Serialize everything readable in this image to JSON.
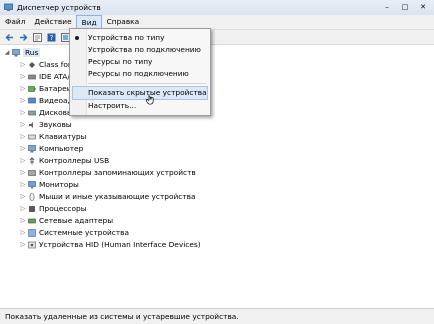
{
  "window": {
    "title": "Диспетчер устройств",
    "controls": [
      "–",
      "□",
      "✕"
    ]
  },
  "menubar": {
    "items": [
      "Файл",
      "Действие",
      "Вид",
      "Справка"
    ],
    "active": "Вид"
  },
  "toolbar": {
    "icons": [
      "back-arrow-icon",
      "forward-arrow-icon",
      "properties-icon",
      "help-icon",
      "view-icon"
    ]
  },
  "tree": {
    "root": "Rus",
    "items": [
      "Class for I",
      "IDE ATA/",
      "Батареи",
      "Видеоада",
      "Дисковы",
      "Звуковы",
      "Клавиатуры",
      "Компьютер",
      "Контроллеры USB",
      "Контроллеры запоминающих устройств",
      "Мониторы",
      "Мыши и иные указывающие устройства",
      "Процессоры",
      "Сетевые адаптеры",
      "Системные устройства",
      "Устройства HID (Human Interface Devices)"
    ]
  },
  "view_menu": {
    "items": [
      "Устройства по типу",
      "Устройства по подключению",
      "Ресурсы по типу",
      "Ресурсы по подключению",
      "Показать скрытые устройства",
      "Настроить..."
    ],
    "checked_item": "Устройства по типу",
    "highlighted_item": "Показать скрытые устройства"
  },
  "status": "Показать удаленные из системы и устаревшие устройства."
}
